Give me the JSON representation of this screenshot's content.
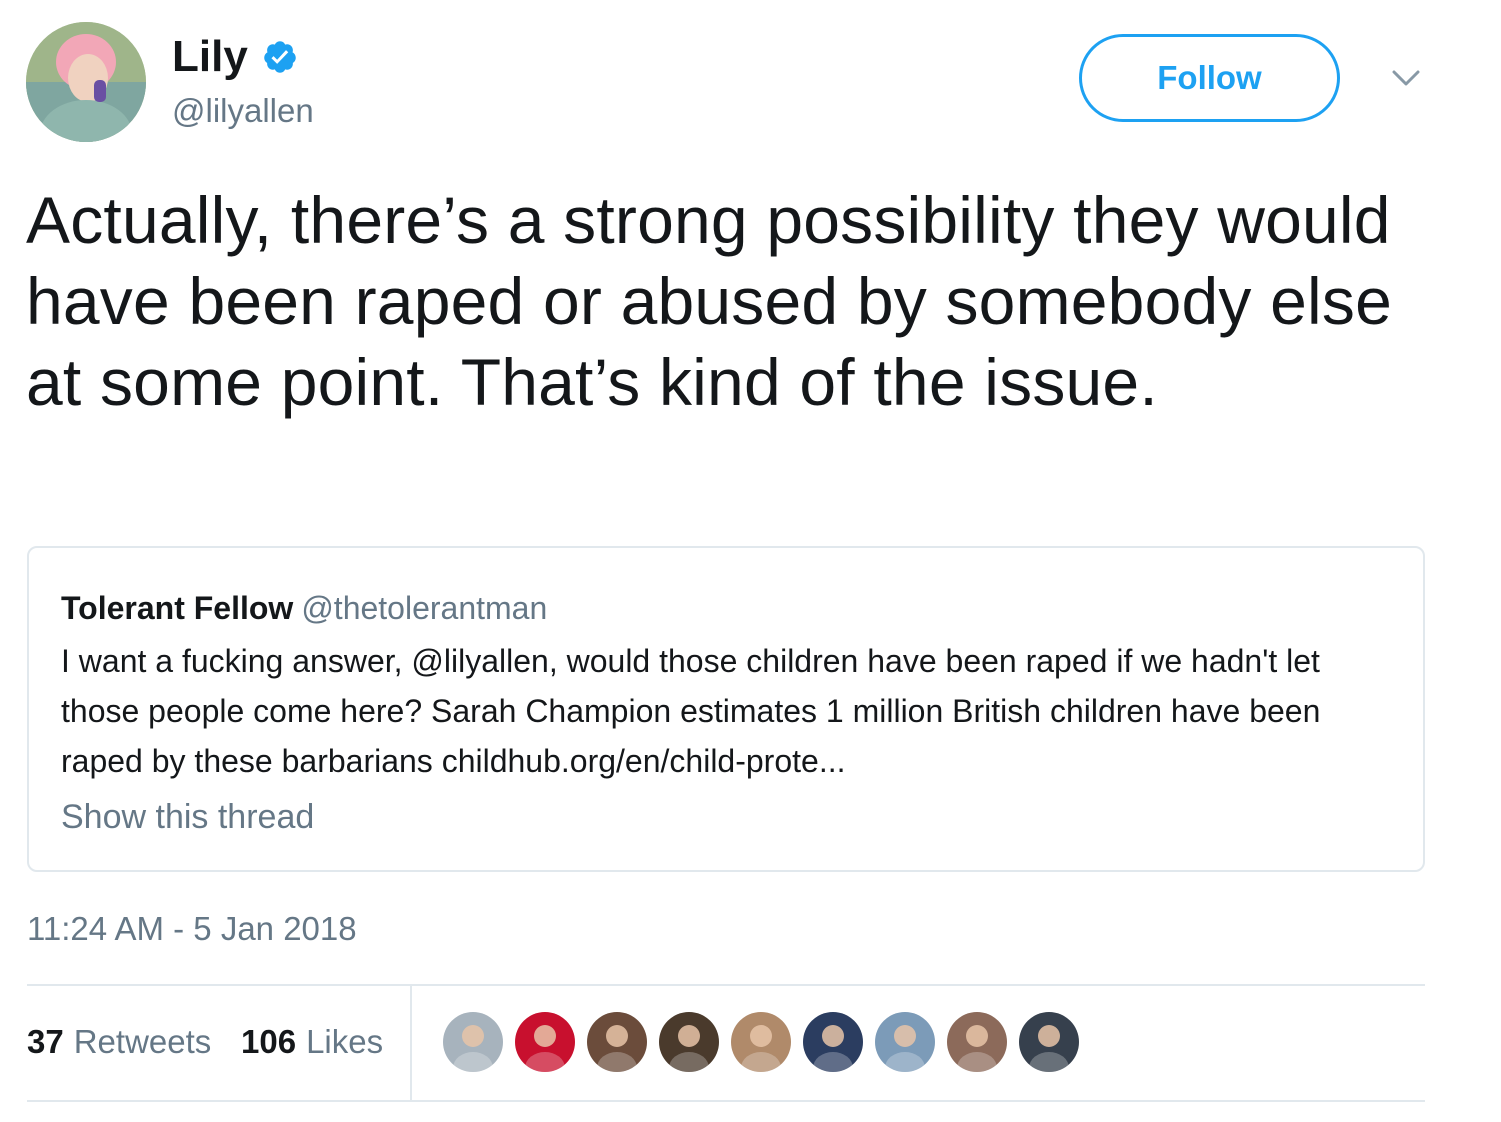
{
  "author": {
    "display_name": "Lily",
    "handle": "@lilyallen",
    "verified": true,
    "avatar_icon": "profile-photo"
  },
  "follow_button": {
    "label": "Follow"
  },
  "menu": {
    "icon": "chevron-down-icon"
  },
  "tweet": {
    "text": "Actually, there’s a strong possibility they would have been raped or abused by somebody else at some point. That’s kind of the issue.",
    "timestamp": "11:24 AM - 5 Jan 2018"
  },
  "quoted_tweet": {
    "author_name": "Tolerant Fellow",
    "author_handle": "@thetolerantman",
    "text": "I want a fucking answer, @lilyallen, would those children have been raped if we hadn't let those people come here? Sarah Champion estimates 1 million British children have been raped by these barbarians childhub.org/en/child-prote...",
    "show_thread_label": "Show this thread"
  },
  "stats": {
    "retweets_count": "37",
    "retweets_label": "Retweets",
    "likes_count": "106",
    "likes_label": "Likes"
  },
  "likers": [
    {
      "name": "liker-avatar-1",
      "color": "#a7b3bd"
    },
    {
      "name": "liker-avatar-2",
      "color": "#c8102e"
    },
    {
      "name": "liker-avatar-3",
      "color": "#6b4c3b"
    },
    {
      "name": "liker-avatar-4",
      "color": "#4a3a2c"
    },
    {
      "name": "liker-avatar-5",
      "color": "#b08a6a"
    },
    {
      "name": "liker-avatar-6",
      "color": "#2b3d60"
    },
    {
      "name": "liker-avatar-7",
      "color": "#7c9bb8"
    },
    {
      "name": "liker-avatar-8",
      "color": "#8c6a5a"
    },
    {
      "name": "liker-avatar-9",
      "color": "#36404d"
    }
  ],
  "colors": {
    "brand": "#1da1f2",
    "secondary_text": "#657786",
    "primary_text": "#14171a",
    "border": "#e1e8ed"
  }
}
